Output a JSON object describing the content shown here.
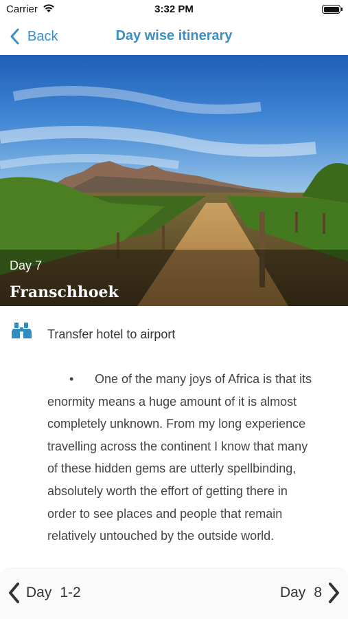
{
  "status_bar": {
    "carrier": "Carrier",
    "time": "3:32 PM"
  },
  "nav": {
    "back_label": "Back",
    "title": "Day wise itinerary"
  },
  "hero": {
    "day_label": "Day 7",
    "place_name": "Franschhoek"
  },
  "activity": {
    "icon": "binoculars-icon",
    "label": "Transfer hotel to airport"
  },
  "description": {
    "bullet": "•",
    "lines": [
      "One of the many joys of Africa is that its",
      "enormity means a huge amount of it is almost",
      "completely unknown. From my long experience",
      "travelling across the continent I know that many",
      "of these hidden gems are utterly spellbinding,",
      "absolutely worth the effort of getting there in",
      "order to see places and people that remain",
      "relatively untouched by the outside world."
    ]
  },
  "footer": {
    "prev_word": "Day",
    "prev_num": "1-2",
    "next_word": "Day",
    "next_num": "8"
  },
  "colors": {
    "accent": "#3a8fc4",
    "icon": "#2f8dc0"
  }
}
